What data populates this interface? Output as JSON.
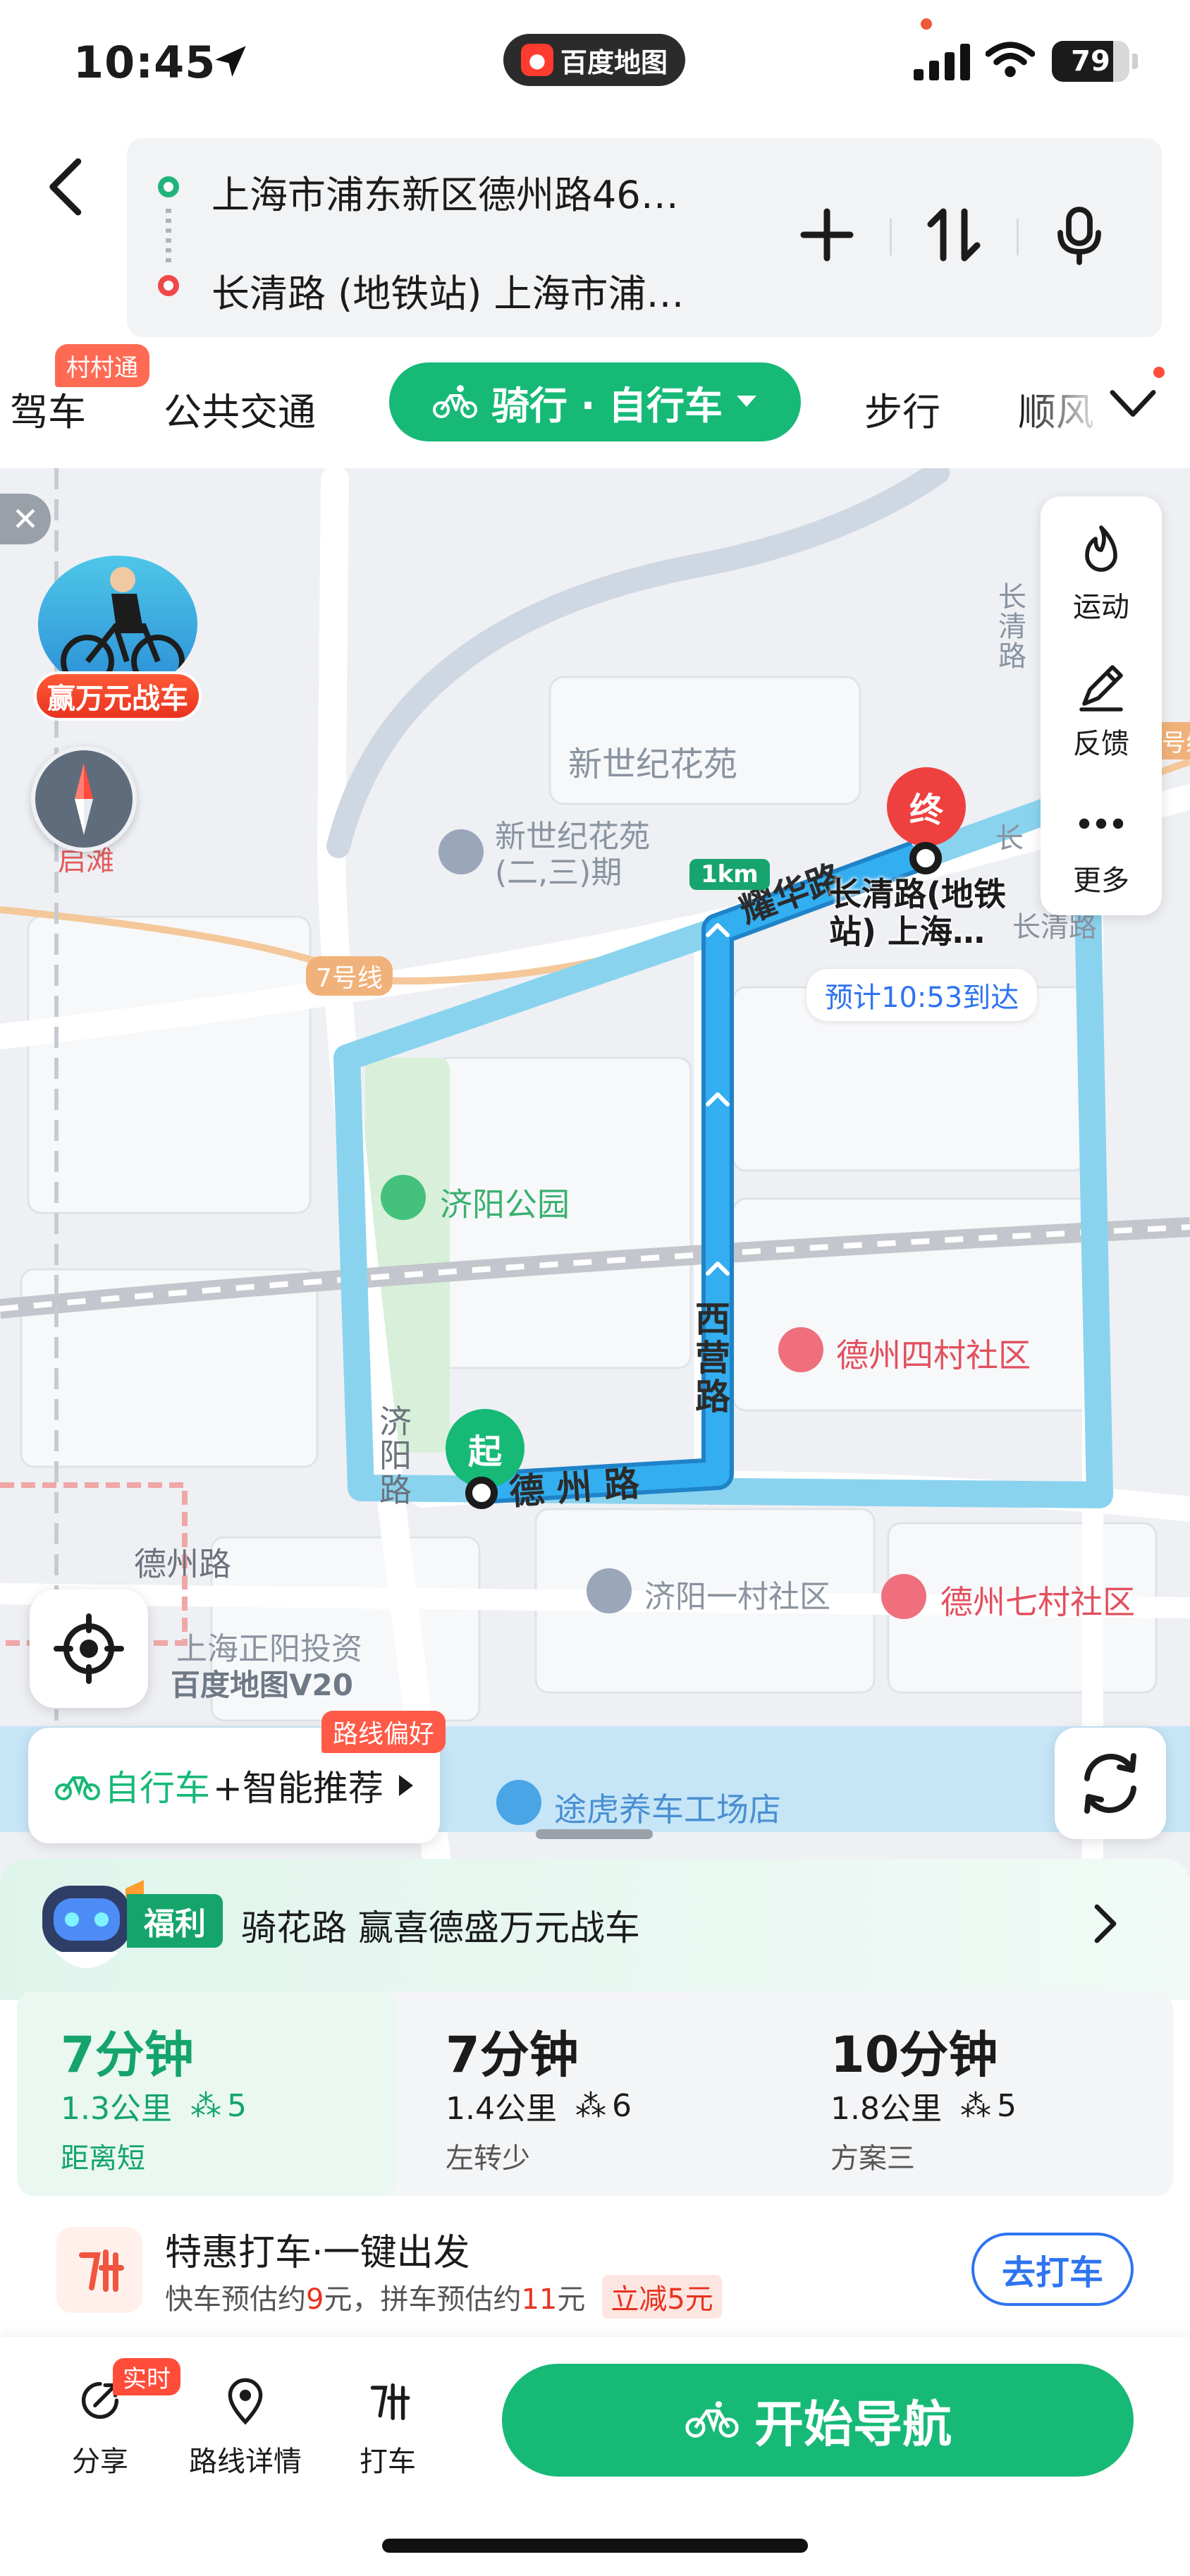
{
  "status_bar": {
    "time": "10:45",
    "app_name": "百度地图",
    "battery": "79",
    "battery_level": 0.79,
    "icons": [
      "location-arrow-icon",
      "signal-icon",
      "wifi-icon",
      "battery-icon"
    ]
  },
  "route": {
    "origin": "上海市浦东新区德州路46…",
    "destination": "长清路 (地铁站) 上海市浦…",
    "actions": [
      "add-waypoint-icon",
      "swap-icon",
      "microphone-icon"
    ]
  },
  "modes": {
    "drive": "驾车",
    "drive_badge": "村村通",
    "transit": "公共交通",
    "active": "骑行 · 自行车",
    "walk": "步行",
    "ride": "顺风"
  },
  "map": {
    "labels": {
      "xinshiji": "新世纪花苑",
      "xinshiji_23": "新世纪花苑\n(二,三)期",
      "jiyang_park": "济阳公园",
      "jiyang_road": "济\n阳\n路",
      "dezhou_road_left": "德州路",
      "dezhou_road_route": "德 州 路",
      "xiying_road": "西\n营\n路",
      "yaohua_road": "耀华路",
      "dezhou_4": "德州四村社区",
      "dezhou_7": "德州七村社区",
      "jiyang_1": "济阳一村社区",
      "zhengyang": "上海正阳投资",
      "version": "百度地图V20",
      "tuhu": "途虎养车工场店",
      "qitan": "启滩",
      "line7": "7号线",
      "changqing_right": "长清路",
      "changqing_top": "长",
      "changqing_vertical": "长\n清\n路",
      "station_code": "号线"
    },
    "distance_marker": "1km",
    "start_marker": "起",
    "end_marker": "终",
    "end_name": "长清路(地铁\n站) 上海…",
    "eta": "预计10:53到达",
    "promo_label": "赢万元战车",
    "close": "✕",
    "side_panel": {
      "sport": "运动",
      "feedback": "反馈",
      "more": "更多"
    },
    "route_pref_badge": "路线偏好",
    "route_pref_bike": "自行车",
    "route_pref_rest": "+智能推荐"
  },
  "colors": {
    "brand_green": "#17b977",
    "route_blue": "#2a9de0",
    "route_light": "#8ad3ef",
    "accent_red": "#e8331f"
  },
  "promo": {
    "tag": "福利",
    "text": "骑花路 赢喜德盛万元战车"
  },
  "plans": [
    {
      "time": "7分钟",
      "distance": "1.3公里",
      "lights": "5",
      "note": "距离短"
    },
    {
      "time": "7分钟",
      "distance": "1.4公里",
      "lights": "6",
      "note": "左转少"
    },
    {
      "time": "10分钟",
      "distance": "1.8公里",
      "lights": "5",
      "note": "方案三"
    }
  ],
  "taxi": {
    "title": "特惠打车·一键出发",
    "sub_a": "快车预估约",
    "price_a": "9",
    "sub_b": "元，拼车预估约",
    "price_b": "11",
    "sub_c": "元",
    "discount": "立减5元",
    "button": "去打车"
  },
  "bottom_nav": {
    "share": "分享",
    "share_badge": "实时",
    "details": "路线详情",
    "taxi": "打车",
    "start": "开始导航"
  }
}
